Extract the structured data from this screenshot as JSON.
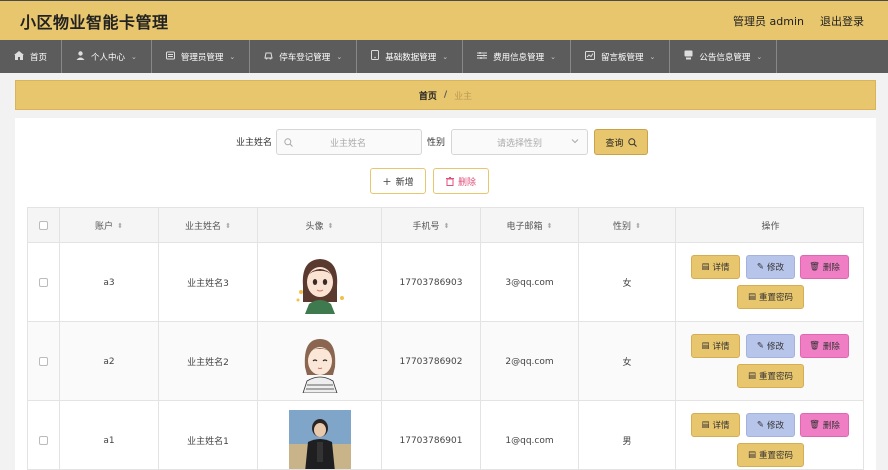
{
  "header": {
    "title": "小区物业智能卡管理",
    "admin_label": "管理员 admin",
    "logout_label": "退出登录"
  },
  "nav": [
    {
      "label": "首页",
      "icon": "home-icon",
      "has_dropdown": false
    },
    {
      "label": "个人中心",
      "icon": "user-icon",
      "has_dropdown": true
    },
    {
      "label": "管理员管理",
      "icon": "admin-icon",
      "has_dropdown": true
    },
    {
      "label": "停车登记管理",
      "icon": "car-icon",
      "has_dropdown": true
    },
    {
      "label": "基础数据管理",
      "icon": "data-icon",
      "has_dropdown": true
    },
    {
      "label": "费用信息管理",
      "icon": "fee-icon",
      "has_dropdown": true
    },
    {
      "label": "留言板管理",
      "icon": "message-icon",
      "has_dropdown": true
    },
    {
      "label": "公告信息管理",
      "icon": "notice-icon",
      "has_dropdown": true
    }
  ],
  "breadcrumb": {
    "home": "首页",
    "separator": "/",
    "current": "业主"
  },
  "search": {
    "name_label": "业主姓名",
    "name_placeholder": "业主姓名",
    "gender_label": "性别",
    "gender_placeholder": "请选择性别",
    "query_label": "查询"
  },
  "actions": {
    "add_label": "新增",
    "delete_label": "删除"
  },
  "table": {
    "headers": [
      "账户",
      "业主姓名",
      "头像",
      "手机号",
      "电子邮箱",
      "性别",
      "操作"
    ],
    "op_labels": {
      "detail": "详情",
      "edit": "修改",
      "delete": "删除",
      "reset": "重置密码"
    },
    "rows": [
      {
        "account": "a3",
        "name": "业主姓名3",
        "avatar": "avatar-girl-1",
        "phone": "17703786903",
        "email": "3@qq.com",
        "gender": "女"
      },
      {
        "account": "a2",
        "name": "业主姓名2",
        "avatar": "avatar-girl-2",
        "phone": "17703786902",
        "email": "2@qq.com",
        "gender": "女"
      },
      {
        "account": "a1",
        "name": "业主姓名1",
        "avatar": "avatar-photo",
        "phone": "17703786901",
        "email": "1@qq.com",
        "gender": "男"
      }
    ]
  },
  "colors": {
    "accent": "#e8c66e",
    "nav_bg": "#5c5c5c",
    "edit": "#b8c5ea",
    "delete": "#f07ec5"
  }
}
